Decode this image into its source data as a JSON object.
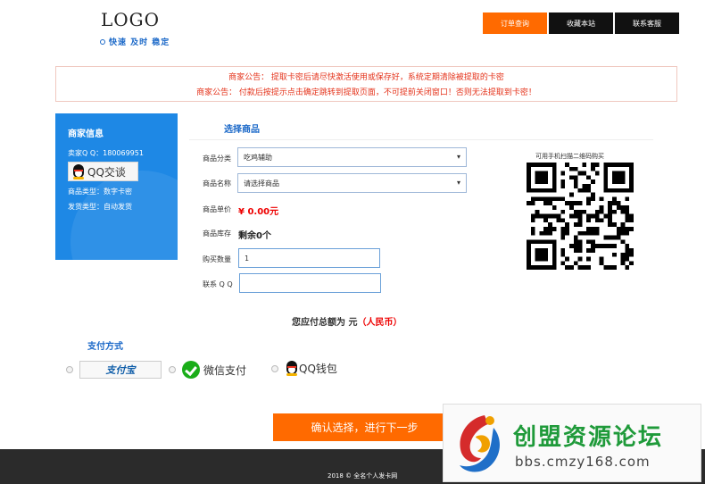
{
  "header": {
    "logo": "LOGO",
    "tagline": "快速 及时 稳定",
    "nav": [
      "订单查询",
      "收藏本站",
      "联系客服"
    ]
  },
  "notice": {
    "line1": "商家公告： 提取卡密后请尽快激活使用或保存好，系统定期清除被提取的卡密",
    "line2": "商家公告： 付款后按提示点击确定跳转到提取页面，不可提前关闭窗口！否则无法提取到卡密！"
  },
  "merchant": {
    "title": "商家信息",
    "qq": "卖家Q Q：180069951",
    "qq_chat": "QQ交谈",
    "goods_type": "商品类型：数字卡密",
    "ship_type": "发货类型：自动发货"
  },
  "goods": {
    "title": "选择商品",
    "category_label": "商品分类",
    "category_value": "吃鸡辅助",
    "name_label": "商品名称",
    "name_value": "请选择商品",
    "price_label": "商品单价",
    "price_value": "¥ 0.00元",
    "stock_label": "商品库存",
    "stock_value": "剩余0个",
    "qty_label": "购买数量",
    "qty_value": "1",
    "contact_label": "联系 Q Q",
    "contact_value": ""
  },
  "qr": {
    "caption": "可用手机扫描二维码购买"
  },
  "total": {
    "prefix": "您应付总额为 元",
    "currency": "（人民币）"
  },
  "payment": {
    "title": "支付方式",
    "alipay": "支付宝",
    "wechat": "微信支付",
    "qqwallet": "QQ钱包"
  },
  "submit": "确认选择，进行下一步",
  "footer": "2018 © 全名个人发卡网",
  "watermark": {
    "cn": "创盟资源论坛",
    "url": "bbs.cmzy168.com"
  },
  "colors": {
    "accent": "#ff6a00",
    "blue": "#1e88e5",
    "notice_red": "#e4321a"
  }
}
